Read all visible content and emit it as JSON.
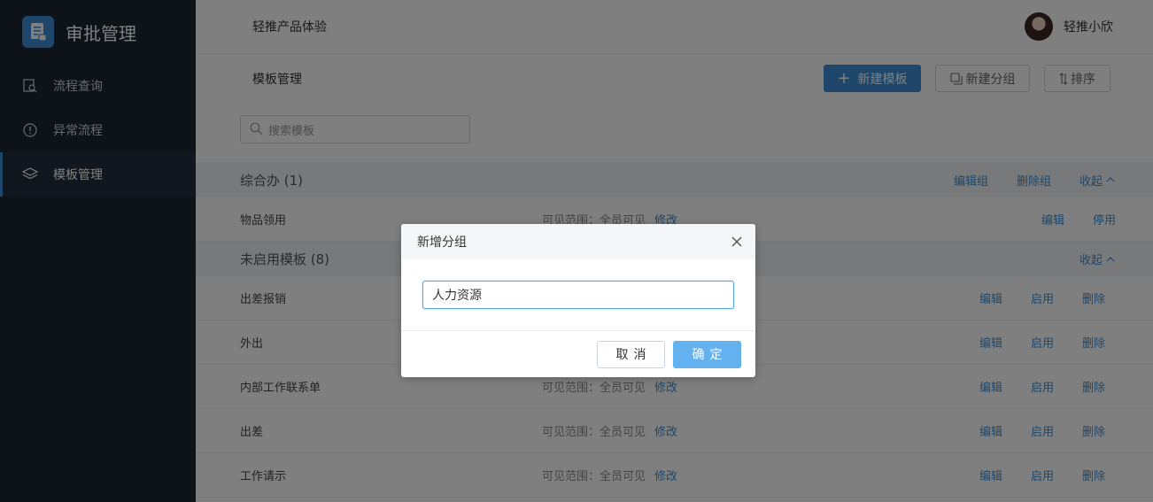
{
  "brand": {
    "title": "审批管理",
    "icon": "document-icon"
  },
  "sidebar": {
    "items": [
      {
        "label": "流程查询",
        "icon": "search-document-icon",
        "active": false
      },
      {
        "label": "异常流程",
        "icon": "alert-circle-icon",
        "active": false
      },
      {
        "label": "模板管理",
        "icon": "layers-icon",
        "active": true
      }
    ]
  },
  "topbar": {
    "app_name": "轻推产品体验",
    "user_name": "轻推小欣"
  },
  "page": {
    "title": "模板管理",
    "new_template": "新建模板",
    "new_group": "新建分组",
    "sort": "排序",
    "search_placeholder": "搜索模板"
  },
  "groups": [
    {
      "title": "综合办 (1)",
      "actions": {
        "edit": "编辑组",
        "delete": "删除组",
        "collapse": "收起"
      },
      "rows": [
        {
          "name": "物品领用",
          "scope": "可见范围：全员可见",
          "scope_edit": "修改",
          "ops": [
            "编辑",
            "停用"
          ]
        }
      ]
    },
    {
      "title": "未启用模板 (8)",
      "actions": {
        "collapse": "收起"
      },
      "rows": [
        {
          "name": "出差报销",
          "scope": "",
          "scope_edit": "",
          "ops": [
            "编辑",
            "启用",
            "删除"
          ]
        },
        {
          "name": "外出",
          "scope": "",
          "scope_edit": "",
          "ops": [
            "编辑",
            "启用",
            "删除"
          ]
        },
        {
          "name": "内部工作联系单",
          "scope": "可见范围：全员可见",
          "scope_edit": "修改",
          "ops": [
            "编辑",
            "启用",
            "删除"
          ]
        },
        {
          "name": "出差",
          "scope": "可见范围：全员可见",
          "scope_edit": "修改",
          "ops": [
            "编辑",
            "启用",
            "删除"
          ]
        },
        {
          "name": "工作请示",
          "scope": "可见范围：全员可见",
          "scope_edit": "修改",
          "ops": [
            "编辑",
            "启用",
            "删除"
          ]
        }
      ]
    }
  ],
  "modal": {
    "title": "新增分组",
    "input_value": "人力资源",
    "cancel": "取消",
    "ok": "确定"
  },
  "colors": {
    "sidebar": "#1d2733",
    "accent": "#3d8fd6",
    "ok_button": "#63b1ee"
  }
}
